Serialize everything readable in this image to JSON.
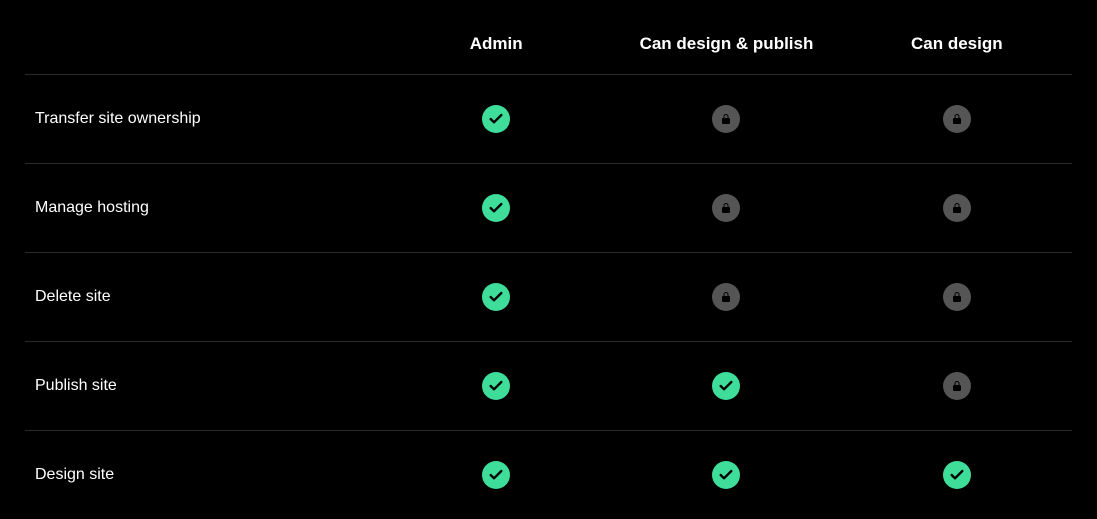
{
  "columns": [
    "",
    "Admin",
    "Can design & publish",
    "Can design"
  ],
  "rows": [
    {
      "feature": "Transfer site ownership",
      "cells": [
        "check",
        "lock",
        "lock"
      ]
    },
    {
      "feature": "Manage hosting",
      "cells": [
        "check",
        "lock",
        "lock"
      ]
    },
    {
      "feature": "Delete site",
      "cells": [
        "check",
        "lock",
        "lock"
      ]
    },
    {
      "feature": "Publish site",
      "cells": [
        "check",
        "check",
        "lock"
      ]
    },
    {
      "feature": "Design site",
      "cells": [
        "check",
        "check",
        "check"
      ]
    }
  ],
  "colors": {
    "check_bg": "#3fdd9a",
    "lock_bg": "#555555"
  }
}
